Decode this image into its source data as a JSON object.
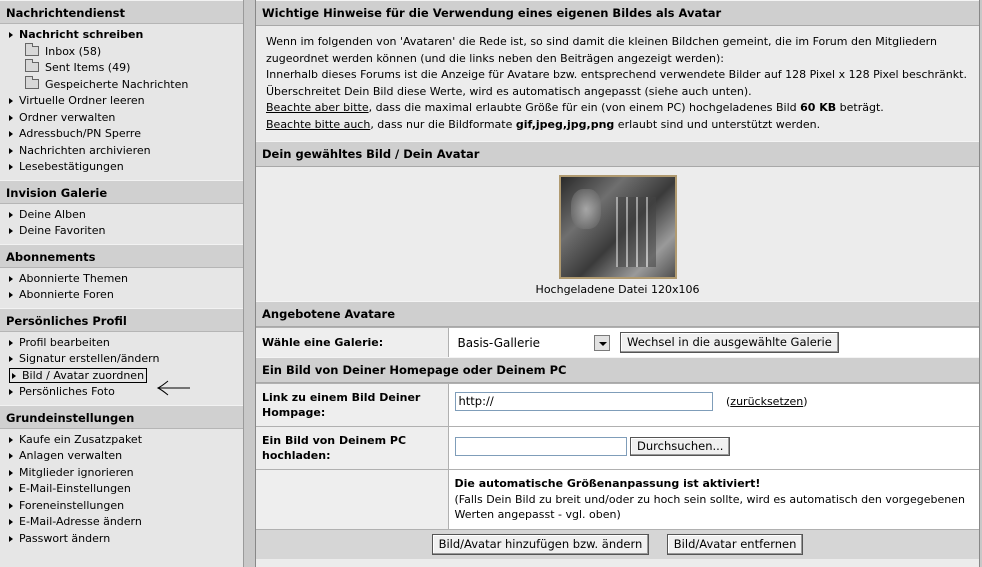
{
  "sidebar": {
    "sections": [
      {
        "title": "Nachrichtendienst",
        "items": [
          {
            "label": "Nachricht schreiben",
            "bold": true
          },
          {
            "label": "Inbox (58)",
            "folder": true
          },
          {
            "label": "Sent Items (49)",
            "folder": true
          },
          {
            "label": "Gespeicherte Nachrichten",
            "folder": true
          },
          {
            "label": "Virtuelle Ordner leeren"
          },
          {
            "label": "Ordner verwalten"
          },
          {
            "label": "Adressbuch/PN Sperre"
          },
          {
            "label": "Nachrichten archivieren"
          },
          {
            "label": "Lesebestätigungen"
          }
        ]
      },
      {
        "title": "Invision Galerie",
        "items": [
          {
            "label": "Deine Alben"
          },
          {
            "label": "Deine Favoriten"
          }
        ]
      },
      {
        "title": "Abonnements",
        "items": [
          {
            "label": "Abonnierte Themen"
          },
          {
            "label": "Abonnierte Foren"
          }
        ]
      },
      {
        "title": "Persönliches Profil",
        "items": [
          {
            "label": "Profil bearbeiten"
          },
          {
            "label": "Signatur erstellen/ändern"
          },
          {
            "label": "Bild / Avatar zuordnen",
            "selected": true
          },
          {
            "label": "Persönliches Foto"
          }
        ]
      },
      {
        "title": "Grundeinstellungen",
        "items": [
          {
            "label": "Kaufe ein Zusatzpaket"
          },
          {
            "label": "Anlagen verwalten"
          },
          {
            "label": "Mitglieder ignorieren"
          },
          {
            "label": "E-Mail-Einstellungen"
          },
          {
            "label": "Foreneinstellungen"
          },
          {
            "label": "E-Mail-Adresse ändern"
          },
          {
            "label": "Passwort ändern"
          }
        ]
      }
    ]
  },
  "main": {
    "hints": {
      "title": "Wichtige Hinweise für die Verwendung eines eigenen Bildes als Avatar",
      "p1": "Wenn im folgenden von 'Avataren' die Rede ist, so sind damit die kleinen Bildchen gemeint, die im Forum den Mitgliedern zugeordnet werden können (und die links neben den Beiträgen angezeigt werden):",
      "p2": "Innerhalb dieses Forums ist die Anzeige für Avatare bzw. entsprechend verwendete Bilder auf 128 Pixel x 128 Pixel beschränkt. Überschreitet Dein Bild diese Werte, wird es automatisch angepasst (siehe auch unten).",
      "p3_link": "Beachte aber bitte",
      "p3_a": ", dass die maximal erlaubte Größe für ein (von einem PC) hochgeladenes Bild ",
      "p3_bold": "60 KB",
      "p3_b": " beträgt.",
      "p4_link": "Beachte bitte auch",
      "p4_a": ", dass nur die Bildformate ",
      "p4_bold": "gif,jpeg,jpg,png",
      "p4_b": " erlaubt sind und unterstützt werden."
    },
    "current_avatar": {
      "title": "Dein gewähltes Bild / Dein Avatar",
      "caption": "Hochgeladene Datei 120x106"
    },
    "gallery": {
      "title": "Angebotene Avatare",
      "label": "Wähle eine Galerie:",
      "selected": "Basis-Gallerie",
      "button": "Wechsel in die ausgewählte Galerie"
    },
    "upload": {
      "title": "Ein Bild von Deiner Homepage oder Deinem PC",
      "url_label": "Link zu einem Bild Deiner Hompage:",
      "url_value": "http://",
      "reset_open": "(",
      "reset_link": "zurücksetzen",
      "reset_close": ")",
      "pc_label": "Ein Bild von Deinem PC hochladen:",
      "browse_button": "Durchsuchen...",
      "notice_bold": "Die automatische Größenanpassung ist aktiviert!",
      "notice_text": "(Falls Dein Bild zu breit und/oder zu hoch sein sollte, wird es automatisch den vorgegebenen Werten angepasst - vgl. oben)"
    },
    "actions": {
      "submit": "Bild/Avatar hinzufügen bzw. ändern",
      "remove": "Bild/Avatar entfernen"
    }
  }
}
